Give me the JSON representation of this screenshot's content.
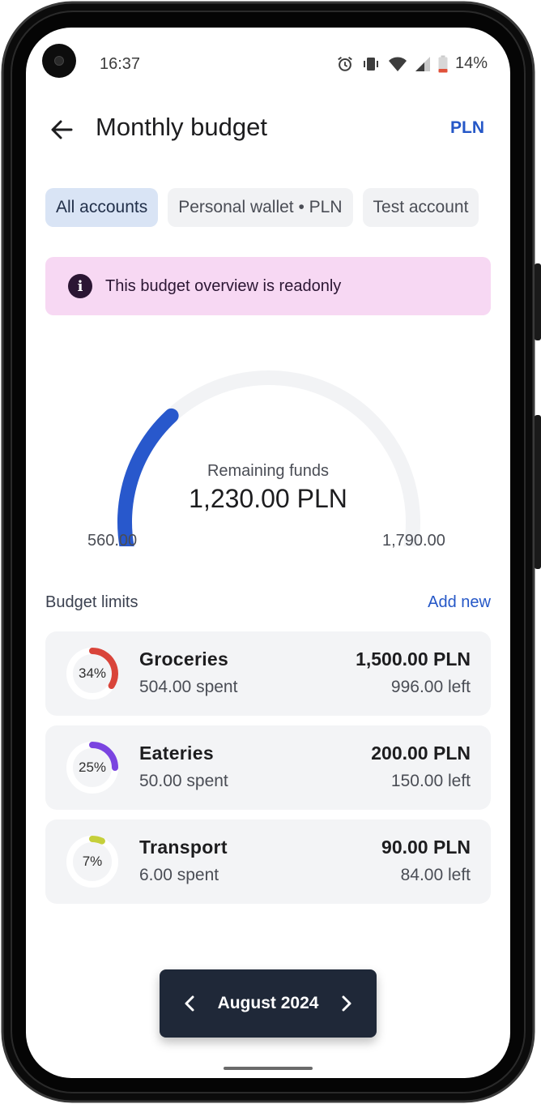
{
  "status_bar": {
    "time": "16:37",
    "battery": "14%",
    "icons": [
      "alarm-icon",
      "vibrate-icon",
      "wifi-icon",
      "cellular-signal-icon",
      "battery-low-icon"
    ]
  },
  "header": {
    "title": "Monthly budget",
    "currency": "PLN",
    "back_icon": "arrow-back-icon"
  },
  "account_chips": [
    {
      "label": "All accounts",
      "selected": true
    },
    {
      "label": "Personal wallet • PLN",
      "selected": false
    },
    {
      "label": "Test account",
      "selected": false
    }
  ],
  "banner": {
    "icon": "info-icon",
    "icon_glyph": "i",
    "text": "This budget overview is readonly",
    "background": "#f7d8f3"
  },
  "gauge": {
    "label": "Remaining funds",
    "value": "1,230.00 PLN",
    "min_label": "560.00",
    "max_label": "1,790.00",
    "min": 560,
    "max": 1790,
    "current": 1230,
    "filled_fraction": 0.31,
    "fill_color": "#2858cc",
    "track_color": "#f2f3f5"
  },
  "limits": {
    "title": "Budget limits",
    "add_new": "Add new",
    "items": [
      {
        "name": "Groceries",
        "percent": "34%",
        "fraction": 0.34,
        "spent": "504.00 spent",
        "limit": "1,500.00 PLN",
        "left": "996.00 left",
        "color": "#d9443a"
      },
      {
        "name": "Eateries",
        "percent": "25%",
        "fraction": 0.25,
        "spent": "50.00 spent",
        "limit": "200.00 PLN",
        "left": "150.00 left",
        "color": "#7a44e0"
      },
      {
        "name": "Transport",
        "percent": "7%",
        "fraction": 0.07,
        "spent": "6.00 spent",
        "limit": "90.00 PLN",
        "left": "84.00 left",
        "color": "#c5cf3a"
      }
    ]
  },
  "month_picker": {
    "label": "August 2024",
    "prev_icon": "chevron-left-icon",
    "next_icon": "chevron-right-icon"
  },
  "colors": {
    "accent": "#2557c7",
    "chip_selected": "#d9e4f5",
    "month_bar": "#1f2838"
  }
}
